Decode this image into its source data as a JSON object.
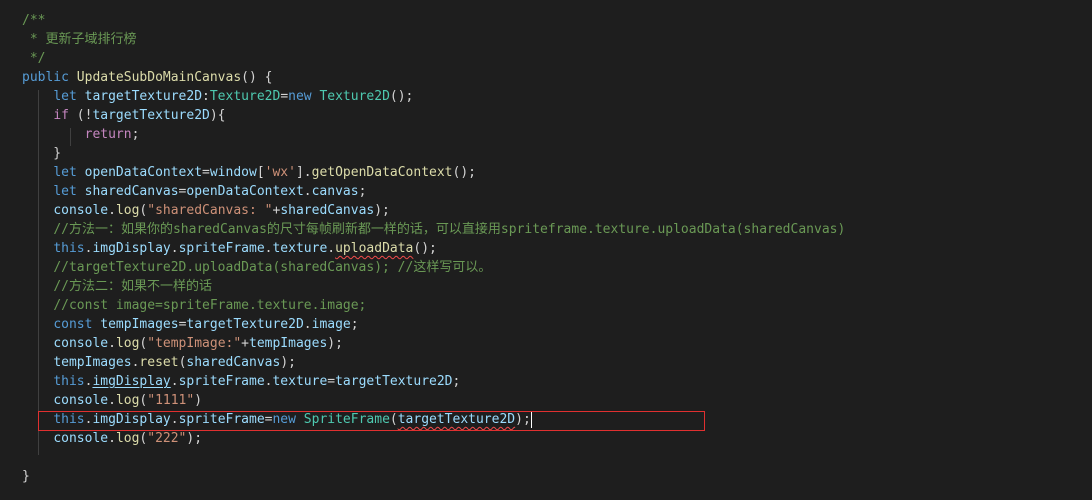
{
  "editor": {
    "lines": [
      [
        {
          "t": "/**",
          "c": "comment"
        }
      ],
      [
        {
          "t": " * ",
          "c": "comment"
        },
        {
          "t": "更新子域排行榜",
          "c": "comment cjk"
        }
      ],
      [
        {
          "t": " */",
          "c": "comment"
        }
      ],
      [
        {
          "t": "public",
          "c": "keyword"
        },
        {
          "t": " ",
          "c": "plain"
        },
        {
          "t": "UpdateSubDoMainCanvas",
          "c": "func"
        },
        {
          "t": "() {",
          "c": "plain"
        }
      ],
      [
        {
          "t": "    ",
          "c": "plain"
        },
        {
          "t": "let",
          "c": "keyword"
        },
        {
          "t": " ",
          "c": "plain"
        },
        {
          "t": "targetTexture2D",
          "c": "var"
        },
        {
          "t": ":",
          "c": "plain"
        },
        {
          "t": "Texture2D",
          "c": "type"
        },
        {
          "t": "=",
          "c": "plain"
        },
        {
          "t": "new",
          "c": "keyword"
        },
        {
          "t": " ",
          "c": "plain"
        },
        {
          "t": "Texture2D",
          "c": "type"
        },
        {
          "t": "();",
          "c": "plain"
        }
      ],
      [
        {
          "t": "    ",
          "c": "plain"
        },
        {
          "t": "if",
          "c": "control"
        },
        {
          "t": " (!",
          "c": "plain"
        },
        {
          "t": "targetTexture2D",
          "c": "var"
        },
        {
          "t": "){",
          "c": "plain"
        }
      ],
      [
        {
          "t": "        ",
          "c": "plain"
        },
        {
          "t": "return",
          "c": "control"
        },
        {
          "t": ";",
          "c": "plain"
        }
      ],
      [
        {
          "t": "    }",
          "c": "plain"
        }
      ],
      [
        {
          "t": "    ",
          "c": "plain"
        },
        {
          "t": "let",
          "c": "keyword"
        },
        {
          "t": " ",
          "c": "plain"
        },
        {
          "t": "openDataContext",
          "c": "var"
        },
        {
          "t": "=",
          "c": "plain"
        },
        {
          "t": "window",
          "c": "var"
        },
        {
          "t": "[",
          "c": "plain"
        },
        {
          "t": "'wx'",
          "c": "str"
        },
        {
          "t": "].",
          "c": "plain"
        },
        {
          "t": "getOpenDataContext",
          "c": "func"
        },
        {
          "t": "();",
          "c": "plain"
        }
      ],
      [
        {
          "t": "    ",
          "c": "plain"
        },
        {
          "t": "let",
          "c": "keyword"
        },
        {
          "t": " ",
          "c": "plain"
        },
        {
          "t": "sharedCanvas",
          "c": "var"
        },
        {
          "t": "=",
          "c": "plain"
        },
        {
          "t": "openDataContext",
          "c": "var"
        },
        {
          "t": ".",
          "c": "plain"
        },
        {
          "t": "canvas",
          "c": "var"
        },
        {
          "t": ";",
          "c": "plain"
        }
      ],
      [
        {
          "t": "    ",
          "c": "plain"
        },
        {
          "t": "console",
          "c": "var"
        },
        {
          "t": ".",
          "c": "plain"
        },
        {
          "t": "log",
          "c": "func"
        },
        {
          "t": "(",
          "c": "plain"
        },
        {
          "t": "\"sharedCanvas: \"",
          "c": "str"
        },
        {
          "t": "+",
          "c": "plain"
        },
        {
          "t": "sharedCanvas",
          "c": "var"
        },
        {
          "t": ");",
          "c": "plain"
        }
      ],
      [
        {
          "t": "    ",
          "c": "plain"
        },
        {
          "t": "//",
          "c": "comment"
        },
        {
          "t": "方法一：如果你的",
          "c": "comment cjk"
        },
        {
          "t": "sharedCanvas",
          "c": "comment"
        },
        {
          "t": "的尺寸每帧刷新都一样的话，可以直接用",
          "c": "comment cjk"
        },
        {
          "t": "spriteframe.texture.uploadData(sharedCanvas)",
          "c": "comment"
        }
      ],
      [
        {
          "t": "    ",
          "c": "plain"
        },
        {
          "t": "this",
          "c": "keyword"
        },
        {
          "t": ".",
          "c": "plain"
        },
        {
          "t": "imgDisplay",
          "c": "var"
        },
        {
          "t": ".",
          "c": "plain"
        },
        {
          "t": "spriteFrame",
          "c": "var"
        },
        {
          "t": ".",
          "c": "plain"
        },
        {
          "t": "texture",
          "c": "var"
        },
        {
          "t": ".",
          "c": "plain"
        },
        {
          "t": "uploadData",
          "c": "func squiggle"
        },
        {
          "t": "();",
          "c": "plain"
        }
      ],
      [
        {
          "t": "    ",
          "c": "plain"
        },
        {
          "t": "//targetTexture2D.uploadData(sharedCanvas); //",
          "c": "comment"
        },
        {
          "t": "这样写可以。",
          "c": "comment cjk"
        }
      ],
      [
        {
          "t": "    ",
          "c": "plain"
        },
        {
          "t": "//",
          "c": "comment"
        },
        {
          "t": "方法二：如果不一样的话",
          "c": "comment cjk"
        }
      ],
      [
        {
          "t": "    ",
          "c": "plain"
        },
        {
          "t": "//const image=spriteFrame.texture.image;",
          "c": "comment"
        }
      ],
      [
        {
          "t": "    ",
          "c": "plain"
        },
        {
          "t": "const",
          "c": "keyword"
        },
        {
          "t": " ",
          "c": "plain"
        },
        {
          "t": "tempImages",
          "c": "var"
        },
        {
          "t": "=",
          "c": "plain"
        },
        {
          "t": "targetTexture2D",
          "c": "var"
        },
        {
          "t": ".",
          "c": "plain"
        },
        {
          "t": "image",
          "c": "var"
        },
        {
          "t": ";",
          "c": "plain"
        }
      ],
      [
        {
          "t": "    ",
          "c": "plain"
        },
        {
          "t": "console",
          "c": "var"
        },
        {
          "t": ".",
          "c": "plain"
        },
        {
          "t": "log",
          "c": "func"
        },
        {
          "t": "(",
          "c": "plain"
        },
        {
          "t": "\"tempImage:\"",
          "c": "str"
        },
        {
          "t": "+",
          "c": "plain"
        },
        {
          "t": "tempImages",
          "c": "var"
        },
        {
          "t": ");",
          "c": "plain"
        }
      ],
      [
        {
          "t": "    ",
          "c": "plain"
        },
        {
          "t": "tempImages",
          "c": "var"
        },
        {
          "t": ".",
          "c": "plain"
        },
        {
          "t": "reset",
          "c": "func"
        },
        {
          "t": "(",
          "c": "plain"
        },
        {
          "t": "sharedCanvas",
          "c": "var"
        },
        {
          "t": ");",
          "c": "plain"
        }
      ],
      [
        {
          "t": "    ",
          "c": "plain"
        },
        {
          "t": "this",
          "c": "keyword"
        },
        {
          "t": ".",
          "c": "plain"
        },
        {
          "t": "imgDisplay",
          "c": "var link-underline"
        },
        {
          "t": ".",
          "c": "plain"
        },
        {
          "t": "spriteFrame",
          "c": "var"
        },
        {
          "t": ".",
          "c": "plain"
        },
        {
          "t": "texture",
          "c": "var"
        },
        {
          "t": "=",
          "c": "plain"
        },
        {
          "t": "targetTexture2D",
          "c": "var"
        },
        {
          "t": ";",
          "c": "plain"
        }
      ],
      [
        {
          "t": "    ",
          "c": "plain"
        },
        {
          "t": "console",
          "c": "var"
        },
        {
          "t": ".",
          "c": "plain"
        },
        {
          "t": "log",
          "c": "func"
        },
        {
          "t": "(",
          "c": "plain"
        },
        {
          "t": "\"1111\"",
          "c": "str"
        },
        {
          "t": ")",
          "c": "plain"
        }
      ],
      [
        {
          "t": "    ",
          "c": "plain"
        },
        {
          "t": "this",
          "c": "keyword"
        },
        {
          "t": ".",
          "c": "plain"
        },
        {
          "t": "imgDisplay",
          "c": "var"
        },
        {
          "t": ".",
          "c": "plain"
        },
        {
          "t": "spriteFrame",
          "c": "var"
        },
        {
          "t": "=",
          "c": "plain"
        },
        {
          "t": "new",
          "c": "keyword"
        },
        {
          "t": " ",
          "c": "plain"
        },
        {
          "t": "SpriteFrame",
          "c": "type"
        },
        {
          "t": "(",
          "c": "plain"
        },
        {
          "t": "targetTexture2D",
          "c": "var squiggle"
        },
        {
          "t": ");",
          "c": "plain"
        },
        {
          "t": "",
          "c": "cursor"
        }
      ],
      [
        {
          "t": "    ",
          "c": "plain"
        },
        {
          "t": "console",
          "c": "var"
        },
        {
          "t": ".",
          "c": "plain"
        },
        {
          "t": "log",
          "c": "func"
        },
        {
          "t": "(",
          "c": "plain"
        },
        {
          "t": "\"222\"",
          "c": "str"
        },
        {
          "t": ");",
          "c": "plain"
        }
      ],
      [
        {
          "t": "",
          "c": "plain"
        }
      ],
      [
        {
          "t": "}",
          "c": "plain"
        }
      ]
    ],
    "colors": {
      "background": "#1e1e1e",
      "comment": "#6a9955",
      "keyword": "#569cd6",
      "control": "#c586c0",
      "type": "#4ec9b0",
      "function": "#dcdcaa",
      "variable": "#9cdcfe",
      "string": "#ce9178",
      "highlight_box": "#e03030"
    }
  }
}
